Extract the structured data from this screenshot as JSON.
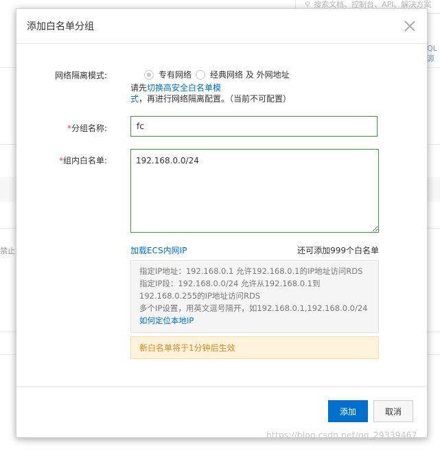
{
  "background": {
    "search_placeholder": "搜索文档、控制台、API、解决方案",
    "right_edge_text": "QL源",
    "left_edge_text": "禁止"
  },
  "dialog": {
    "title": "添加白名单分组",
    "network_mode": {
      "label": "网络隔离模式:",
      "option_vpc": "专有网络",
      "option_classic": "经典网络 及 外网地址",
      "note_prefix": "请先",
      "note_link": "切换高安全白名单模式",
      "note_suffix": "，再进行网络隔离配置。（当前不可配置）"
    },
    "group_name": {
      "required_mark": "*",
      "label": "分组名称:",
      "value": "fc"
    },
    "whitelist": {
      "required_mark": "*",
      "label": "组内白名单:",
      "value": "192.168.0.0/24"
    },
    "load_ecs_link": "加载ECS内网IP",
    "remaining_text": "还可添加999个白名单",
    "tips": [
      "指定IP地址：192.168.0.1 允许192.168.0.1的IP地址访问RDS",
      "指定IP段：192.168.0.0/24 允许从192.168.0.1到192.168.0.255的IP地址访问RDS",
      "多个IP设置，用英文逗号隔开，如192.168.0.1,192.168.0.0/24"
    ],
    "tips_link": "如何定位本地IP",
    "notice": "新白名单将于1分钟后生效",
    "buttons": {
      "submit": "添加",
      "cancel": "取消"
    }
  },
  "watermark": "https://blog.csdn.net/qq_29339467",
  "colors": {
    "primary": "#0070cc",
    "required": "#e4393c",
    "valid_border": "#3c9a3c",
    "notice_text": "#e2851d"
  }
}
